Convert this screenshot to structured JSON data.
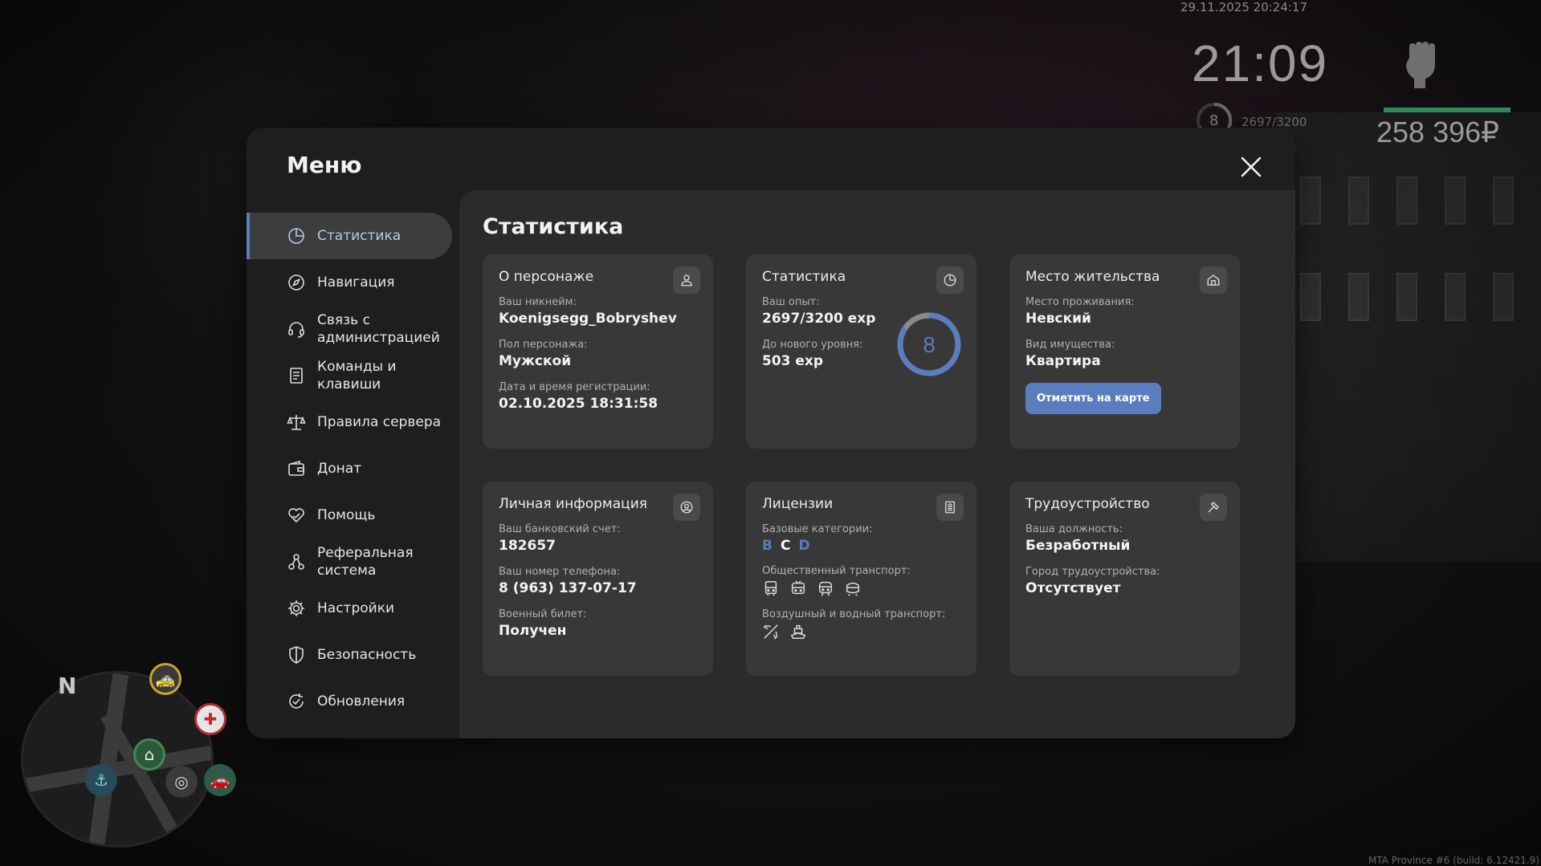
{
  "hud": {
    "datetime": "29.11.2025 20:24:17",
    "clock": "21:09",
    "level": "8",
    "exp": "2697/3200",
    "money": "258 396₽",
    "build": "MTA Province #6 (build: 6.12421.9)"
  },
  "minimap": {
    "north": "N"
  },
  "modal": {
    "title": "Меню",
    "close_icon": "close-icon"
  },
  "sidebar": {
    "items": [
      {
        "label": "Статистика",
        "icon": "pie-chart-icon",
        "active": true
      },
      {
        "label": "Навигация",
        "icon": "compass-icon"
      },
      {
        "label": "Связь с администрацией",
        "icon": "headset-icon"
      },
      {
        "label": "Команды и клавиши",
        "icon": "document-icon"
      },
      {
        "label": "Правила сервера",
        "icon": "scales-icon"
      },
      {
        "label": "Донат",
        "icon": "wallet-icon"
      },
      {
        "label": "Помощь",
        "icon": "heart-hand-icon"
      },
      {
        "label": "Реферальная система",
        "icon": "referral-icon"
      },
      {
        "label": "Настройки",
        "icon": "gear-icon"
      },
      {
        "label": "Безопасность",
        "icon": "shield-icon"
      },
      {
        "label": "Обновления",
        "icon": "refresh-check-icon"
      }
    ]
  },
  "content": {
    "title": "Статистика",
    "character": {
      "title": "О персонаже",
      "nick_label": "Ваш никнейм:",
      "nick": "Koenigsegg_Bobryshev",
      "gender_label": "Пол персонажа:",
      "gender": "Мужской",
      "reg_label": "Дата и время регистрации:",
      "reg": "02.10.2025 18:31:58"
    },
    "stats": {
      "title": "Статистика",
      "exp_label": "Ваш опыт:",
      "exp": "2697/3200 exp",
      "next_label": "До нового уровня:",
      "next": "503 exp",
      "level": "8",
      "progress": 0.843
    },
    "residence": {
      "title": "Место жительства",
      "place_label": "Место проживания:",
      "place": "Невский",
      "type_label": "Вид имущества:",
      "type": "Квартира",
      "button": "Отметить на карте"
    },
    "personal": {
      "title": "Личная информация",
      "bank_label": "Ваш банковский счет:",
      "bank": "182657",
      "phone_label": "Ваш номер телефона:",
      "phone": "8 (963) 137-07-17",
      "military_label": "Военный билет:",
      "military": "Получен"
    },
    "licenses": {
      "title": "Лицензии",
      "base_label": "Базовые категории:",
      "categories": [
        "B",
        "C",
        "D"
      ],
      "public_label": "Общественный транспорт:",
      "air_label": "Воздушный и водный транспорт:"
    },
    "employment": {
      "title": "Трудоустройство",
      "position_label": "Ваша должность:",
      "position": "Безработный",
      "city_label": "Город трудоустройства:",
      "city": "Отсутствует"
    }
  },
  "colors": {
    "accent": "#5a7dbf",
    "cat_b": "#5a7dbf",
    "cat_c": "#ffffff",
    "cat_d": "#5a7dbf"
  }
}
